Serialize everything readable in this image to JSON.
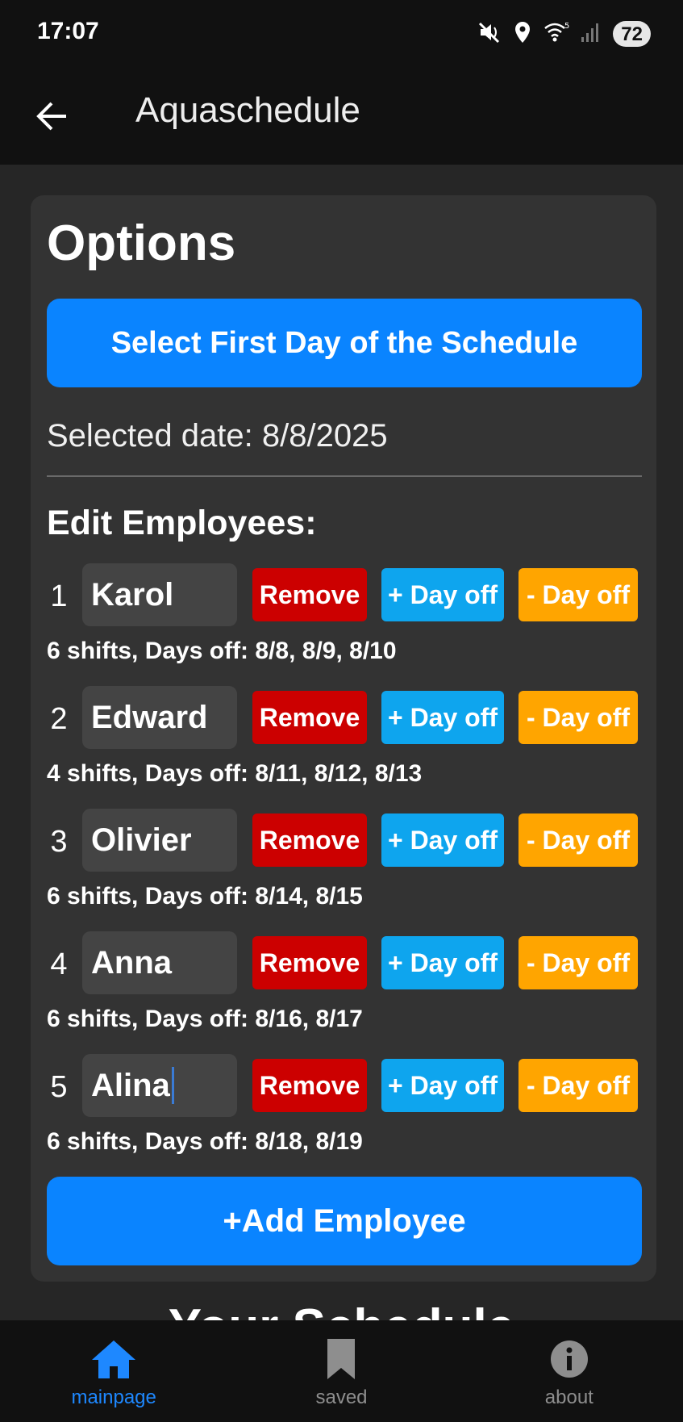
{
  "status_bar": {
    "time": "17:07",
    "battery": "72"
  },
  "app_bar": {
    "title": "Aquaschedule"
  },
  "options": {
    "title": "Options",
    "select_date_label": "Select First Day of the Schedule",
    "selected_date_text": "Selected date: 8/8/2025",
    "edit_employees_title": "Edit Employees:",
    "buttons": {
      "remove": "Remove",
      "add_day_off": "+ Day off",
      "remove_day_off": "- Day off"
    },
    "employees": [
      {
        "index": "1",
        "name": "Karol",
        "info": "6 shifts, Days off: 8/8, 8/9, 8/10"
      },
      {
        "index": "2",
        "name": "Edward",
        "info": "4 shifts, Days off: 8/11, 8/12, 8/13"
      },
      {
        "index": "3",
        "name": "Olivier",
        "info": "6 shifts, Days off: 8/14, 8/15"
      },
      {
        "index": "4",
        "name": "Anna",
        "info": "6 shifts, Days off: 8/16, 8/17"
      },
      {
        "index": "5",
        "name": "Alina",
        "info": "6 shifts, Days off: 8/18, 8/19"
      }
    ],
    "add_employee_label": "+Add Employee"
  },
  "next_section": {
    "title_partial": "Your Schedule"
  },
  "bottom_nav": {
    "items": [
      {
        "label": "mainpage",
        "icon": "home-icon",
        "active": true
      },
      {
        "label": "saved",
        "icon": "bookmark-icon",
        "active": false
      },
      {
        "label": "about",
        "icon": "info-icon",
        "active": false
      }
    ]
  },
  "colors": {
    "primary": "#0a84ff",
    "remove": "#cc0000",
    "add_day_off": "#0ea5ee",
    "remove_day_off": "#ffa500",
    "card": "#333333",
    "background": "#262626"
  }
}
